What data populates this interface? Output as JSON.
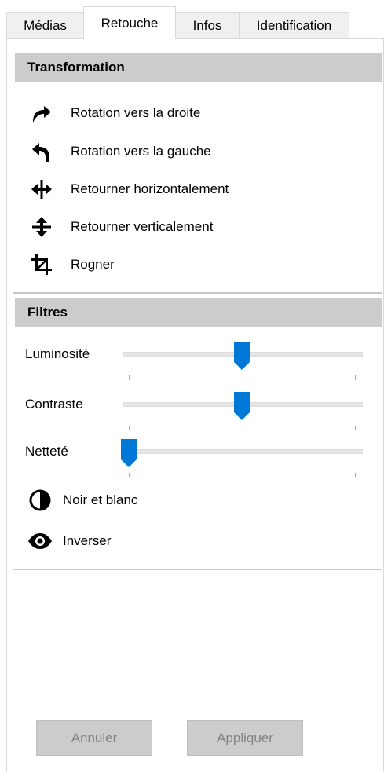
{
  "tabs": [
    {
      "label": "Médias"
    },
    {
      "label": "Retouche",
      "active": true
    },
    {
      "label": "Infos"
    },
    {
      "label": "Identification"
    }
  ],
  "transformation": {
    "title": "Transformation",
    "items": [
      {
        "label": "Rotation vers la droite",
        "icon": "rotate-right-icon"
      },
      {
        "label": "Rotation vers la gauche",
        "icon": "rotate-left-icon"
      },
      {
        "label": "Retourner horizontalement",
        "icon": "flip-horizontal-icon"
      },
      {
        "label": "Retourner verticalement",
        "icon": "flip-vertical-icon"
      },
      {
        "label": "Rogner",
        "icon": "crop-icon"
      }
    ]
  },
  "filters": {
    "title": "Filtres",
    "sliders": [
      {
        "label": "Luminosité",
        "level": 0.5
      },
      {
        "label": "Contraste",
        "level": 0.5
      },
      {
        "label": "Netteté",
        "level": 0.0
      }
    ],
    "items": [
      {
        "label": "Noir et blanc",
        "icon": "contrast-icon"
      },
      {
        "label": "Inverser",
        "icon": "eye-icon"
      }
    ]
  },
  "buttons": {
    "cancel": "Annuler",
    "apply": "Appliquer"
  },
  "colors": {
    "accent": "#0078d7",
    "section_header_bg": "#cccccc",
    "button_disabled_bg": "#cccccc",
    "button_disabled_text": "#838383"
  }
}
